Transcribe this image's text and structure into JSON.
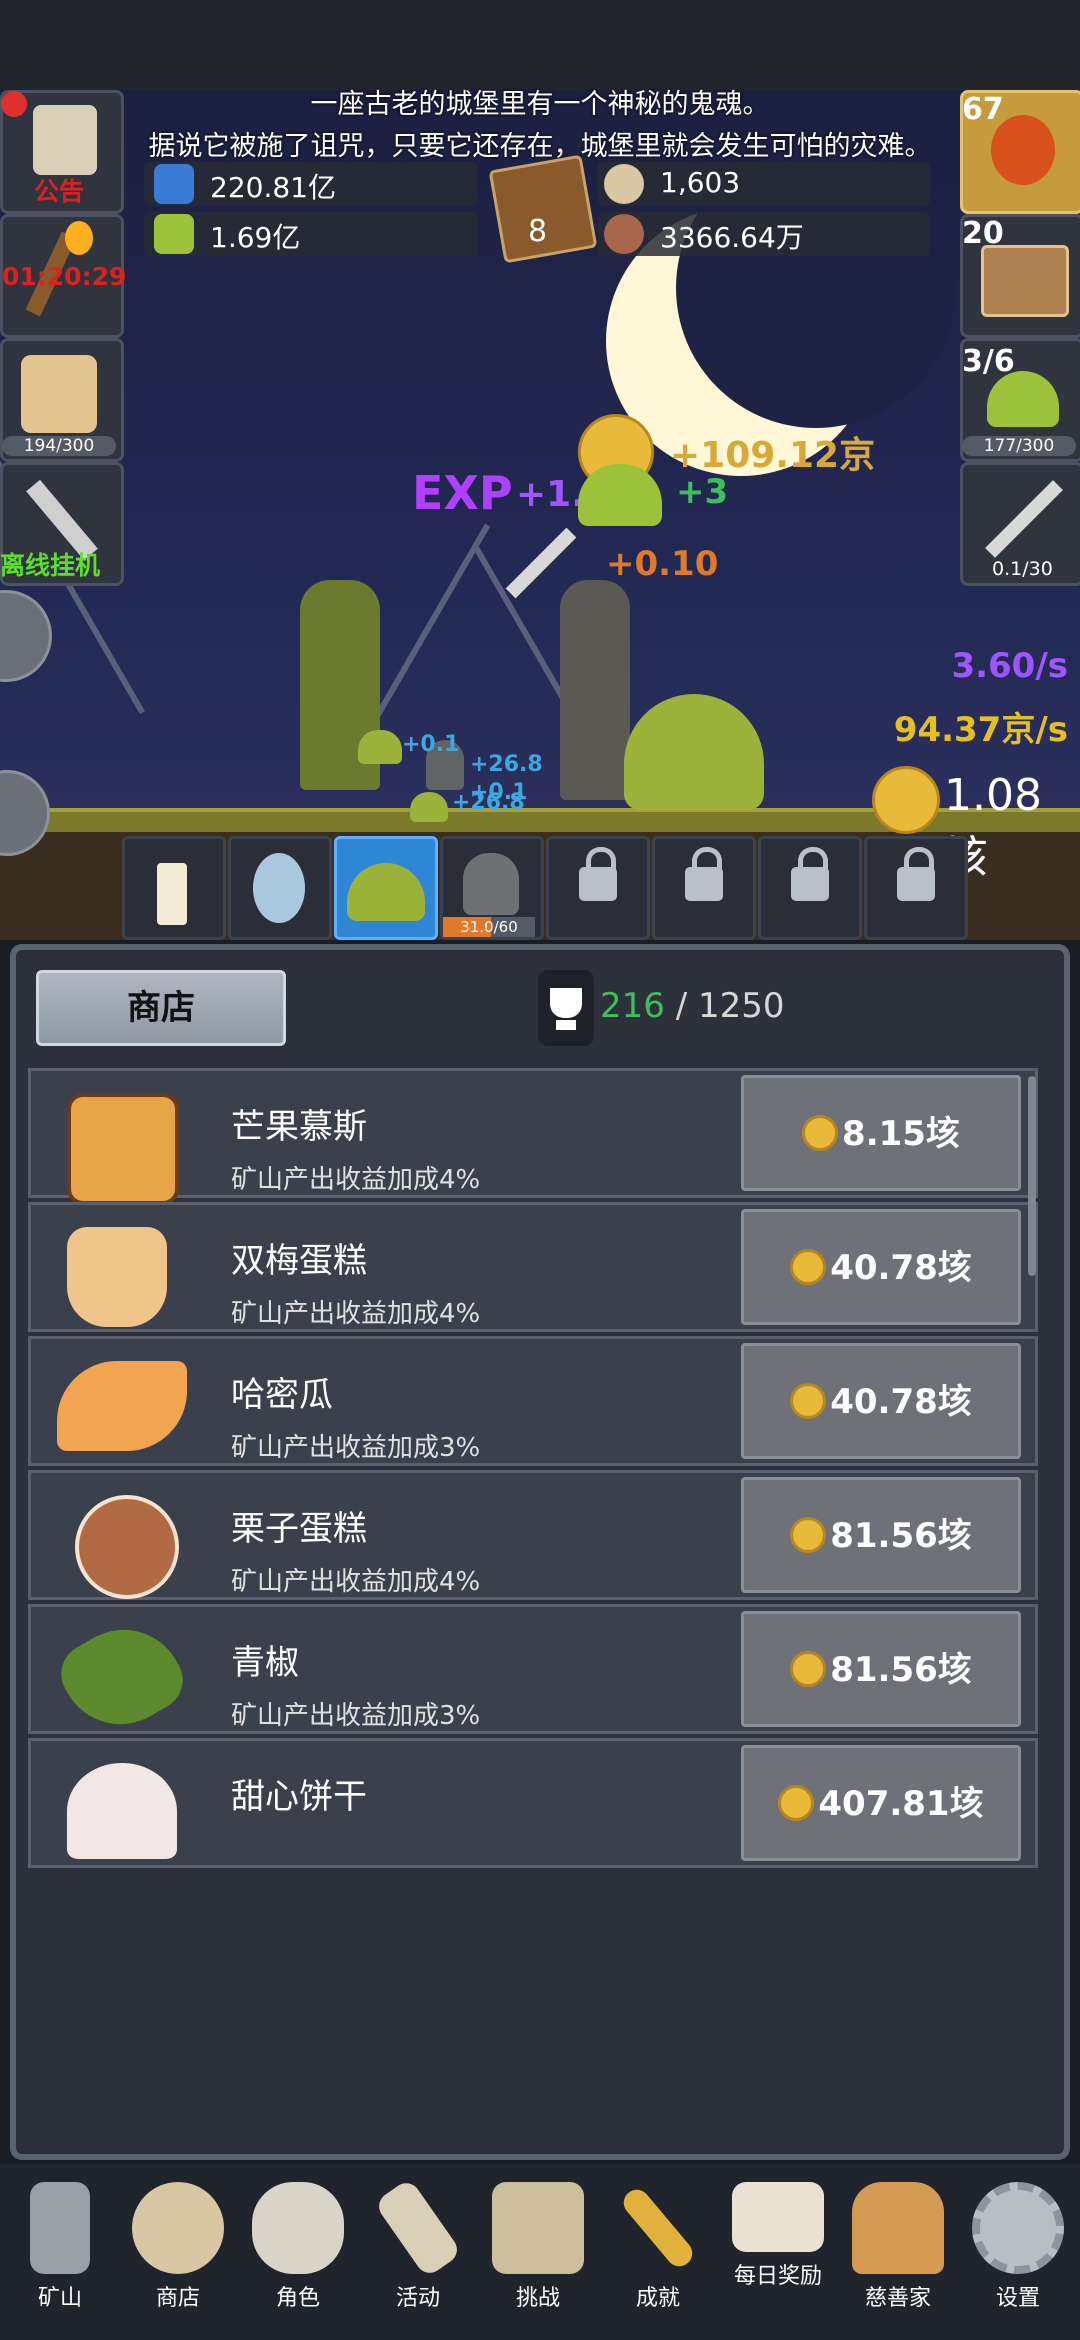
{
  "story": {
    "line1": "一座古老的城堡里有一个神秘的鬼魂。",
    "line2": "据说它被施了诅咒，只要它还存在，城堡里就会发生可怕的灾难。"
  },
  "resources": {
    "blue_potion": "220.81亿",
    "green_potion": "1.69亿",
    "book_count": "8",
    "stone": "1,603",
    "meat": "3366.64万"
  },
  "left_side": {
    "notice_label": "公告",
    "timer": "01:20:29",
    "drink_progress": "194/300",
    "offline_label": "离线挂机"
  },
  "right_side": {
    "potion_count": "67",
    "chest_count": "20",
    "slime_count": "3/6",
    "slime_progress": "177/300",
    "sword_progress": "0.1/30"
  },
  "floaters": {
    "exp_label": "EXP",
    "exp_gain": "+1.2",
    "gold_gain": "+109.12京",
    "slime_gain": "+3",
    "sword_gain": "+0.10",
    "small1": "+0.1",
    "small2": "+26.8",
    "small3": "+0.1",
    "small4": "+26.8"
  },
  "rates": {
    "exp_rate": "3.60/s",
    "gold_rate": "94.37京/s",
    "gold_total": "1.08垓"
  },
  "creature_slots": {
    "slot4_progress": "31.0/60"
  },
  "shop": {
    "tab_label": "商店",
    "trophy_current": "216",
    "trophy_sep": " / ",
    "trophy_total": "1250",
    "items": [
      {
        "name": "芒果慕斯",
        "desc": "矿山产出收益加成4%",
        "price": "8.15垓"
      },
      {
        "name": "双梅蛋糕",
        "desc": "矿山产出收益加成4%",
        "price": "40.78垓"
      },
      {
        "name": "哈密瓜",
        "desc": "矿山产出收益加成3%",
        "price": "40.78垓"
      },
      {
        "name": "栗子蛋糕",
        "desc": "矿山产出收益加成4%",
        "price": "81.56垓"
      },
      {
        "name": "青椒",
        "desc": "矿山产出收益加成3%",
        "price": "81.56垓"
      },
      {
        "name": "甜心饼干",
        "desc": "",
        "price": "407.81垓"
      }
    ]
  },
  "nav": [
    {
      "label": "矿山",
      "icon": "lantern-icon"
    },
    {
      "label": "商店",
      "icon": "shop-stone-icon"
    },
    {
      "label": "角色",
      "icon": "skull-icon"
    },
    {
      "label": "活动",
      "icon": "scroll-icon"
    },
    {
      "label": "挑战",
      "icon": "map-icon"
    },
    {
      "label": "成就",
      "icon": "key-icon"
    },
    {
      "label": "每日奖励",
      "icon": "letter-icon"
    },
    {
      "label": "慈善家",
      "icon": "bread-icon"
    },
    {
      "label": "设置",
      "icon": "gear-icon"
    }
  ]
}
